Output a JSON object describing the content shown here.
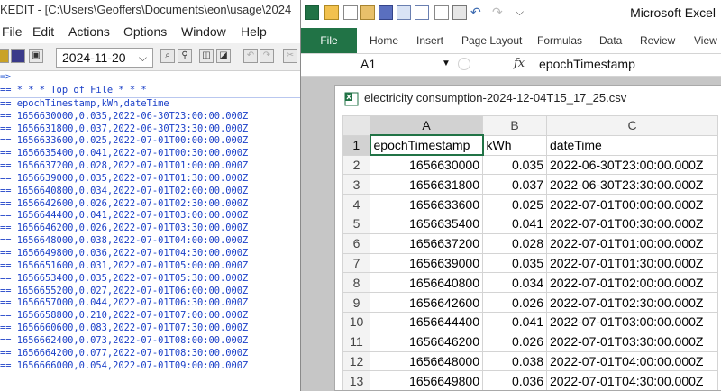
{
  "editor": {
    "title": "KEDIT - [C:\\Users\\Geoffers\\Documents\\eon\\usage\\2024",
    "menu": [
      "File",
      "Edit",
      "Actions",
      "Options",
      "Window",
      "Help"
    ],
    "date_value": "2024-11-20",
    "command_line": "=>",
    "lines": [
      "== * * * Top of File * * *",
      "== epochTimestamp,kWh,dateTime",
      "== 1656630000,0.035,2022-06-30T23:00:00.000Z",
      "== 1656631800,0.037,2022-06-30T23:30:00.000Z",
      "== 1656633600,0.025,2022-07-01T00:00:00.000Z",
      "== 1656635400,0.041,2022-07-01T00:30:00.000Z",
      "== 1656637200,0.028,2022-07-01T01:00:00.000Z",
      "== 1656639000,0.035,2022-07-01T01:30:00.000Z",
      "== 1656640800,0.034,2022-07-01T02:00:00.000Z",
      "== 1656642600,0.026,2022-07-01T02:30:00.000Z",
      "== 1656644400,0.041,2022-07-01T03:00:00.000Z",
      "== 1656646200,0.026,2022-07-01T03:30:00.000Z",
      "== 1656648000,0.038,2022-07-01T04:00:00.000Z",
      "== 1656649800,0.036,2022-07-01T04:30:00.000Z",
      "== 1656651600,0.031,2022-07-01T05:00:00.000Z",
      "== 1656653400,0.035,2022-07-01T05:30:00.000Z",
      "== 1656655200,0.027,2022-07-01T06:00:00.000Z",
      "== 1656657000,0.044,2022-07-01T06:30:00.000Z",
      "== 1656658800,0.210,2022-07-01T07:00:00.000Z",
      "== 1656660600,0.083,2022-07-01T07:30:00.000Z",
      "== 1656662400,0.073,2022-07-01T08:00:00.000Z",
      "== 1656664200,0.077,2022-07-01T08:30:00.000Z",
      "== 1656666000,0.054,2022-07-01T09:00:00.000Z"
    ]
  },
  "excel": {
    "app_title": "Microsoft Excel",
    "tabs": [
      "File",
      "Home",
      "Insert",
      "Page Layout",
      "Formulas",
      "Data",
      "Review",
      "View"
    ],
    "name_box": "A1",
    "fx_label": "fx",
    "formula_value": "epochTimestamp",
    "doc_title": "electricity consumption-2024-12-04T15_17_25.csv",
    "column_headers": [
      "A",
      "B",
      "C"
    ],
    "rows": [
      {
        "n": "1",
        "a": "epochTimestamp",
        "b": "kWh",
        "c": "dateTime"
      },
      {
        "n": "2",
        "a": "1656630000",
        "b": "0.035",
        "c": "2022-06-30T23:00:00.000Z"
      },
      {
        "n": "3",
        "a": "1656631800",
        "b": "0.037",
        "c": "2022-06-30T23:30:00.000Z"
      },
      {
        "n": "4",
        "a": "1656633600",
        "b": "0.025",
        "c": "2022-07-01T00:00:00.000Z"
      },
      {
        "n": "5",
        "a": "1656635400",
        "b": "0.041",
        "c": "2022-07-01T00:30:00.000Z"
      },
      {
        "n": "6",
        "a": "1656637200",
        "b": "0.028",
        "c": "2022-07-01T01:00:00.000Z"
      },
      {
        "n": "7",
        "a": "1656639000",
        "b": "0.035",
        "c": "2022-07-01T01:30:00.000Z"
      },
      {
        "n": "8",
        "a": "1656640800",
        "b": "0.034",
        "c": "2022-07-01T02:00:00.000Z"
      },
      {
        "n": "9",
        "a": "1656642600",
        "b": "0.026",
        "c": "2022-07-01T02:30:00.000Z"
      },
      {
        "n": "10",
        "a": "1656644400",
        "b": "0.041",
        "c": "2022-07-01T03:00:00.000Z"
      },
      {
        "n": "11",
        "a": "1656646200",
        "b": "0.026",
        "c": "2022-07-01T03:30:00.000Z"
      },
      {
        "n": "12",
        "a": "1656648000",
        "b": "0.038",
        "c": "2022-07-01T04:00:00.000Z"
      },
      {
        "n": "13",
        "a": "1656649800",
        "b": "0.036",
        "c": "2022-07-01T04:30:00.000Z"
      }
    ]
  },
  "colors": {
    "excel_green": "#217346",
    "editor_text": "#1a3fc8"
  }
}
